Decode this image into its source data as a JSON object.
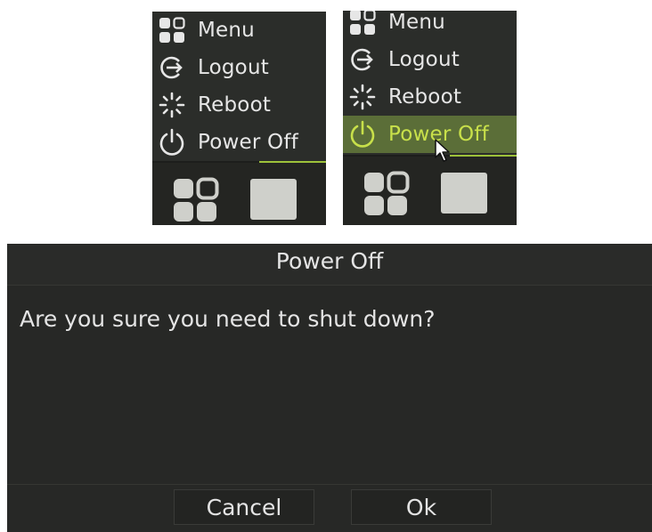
{
  "menu_panel_default": {
    "items": [
      {
        "label": "Menu",
        "icon": "menu-grid-icon"
      },
      {
        "label": "Logout",
        "icon": "logout-icon"
      },
      {
        "label": "Reboot",
        "icon": "reboot-icon"
      },
      {
        "label": "Power Off",
        "icon": "power-icon"
      }
    ]
  },
  "menu_panel_hover": {
    "items": [
      {
        "label": "Menu",
        "icon": "menu-grid-icon"
      },
      {
        "label": "Logout",
        "icon": "logout-icon"
      },
      {
        "label": "Reboot",
        "icon": "reboot-icon"
      },
      {
        "label": "Power Off",
        "icon": "power-icon",
        "state": "hovered"
      }
    ]
  },
  "dialog": {
    "title": "Power Off",
    "message": "Are you sure you need to shut down?",
    "cancel_label": "Cancel",
    "ok_label": "Ok"
  },
  "colors": {
    "panel_bg": "#2b2d2a",
    "hover_bg": "#5b6e38",
    "hover_text": "#c8e04a",
    "dialog_bg": "#272826",
    "text": "#e4e4e4"
  }
}
